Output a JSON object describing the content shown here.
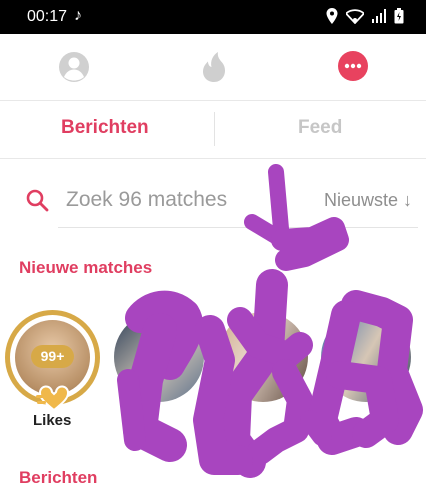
{
  "status": {
    "time": "00:17"
  },
  "nav": {
    "icons": [
      "profile-icon",
      "flame-icon",
      "messages-icon"
    ]
  },
  "tabs": {
    "messages": "Berichten",
    "feed": "Feed"
  },
  "search": {
    "placeholder": "Zoek 96 matches",
    "sort": "Nieuwste ↓"
  },
  "sections": {
    "new_matches": "Nieuwe matches",
    "messages": "Berichten"
  },
  "likes": {
    "count": "99+",
    "label": "Likes"
  },
  "colors": {
    "accent": "#e03e61",
    "gold": "#d7a947",
    "scribble": "#a845bf"
  }
}
